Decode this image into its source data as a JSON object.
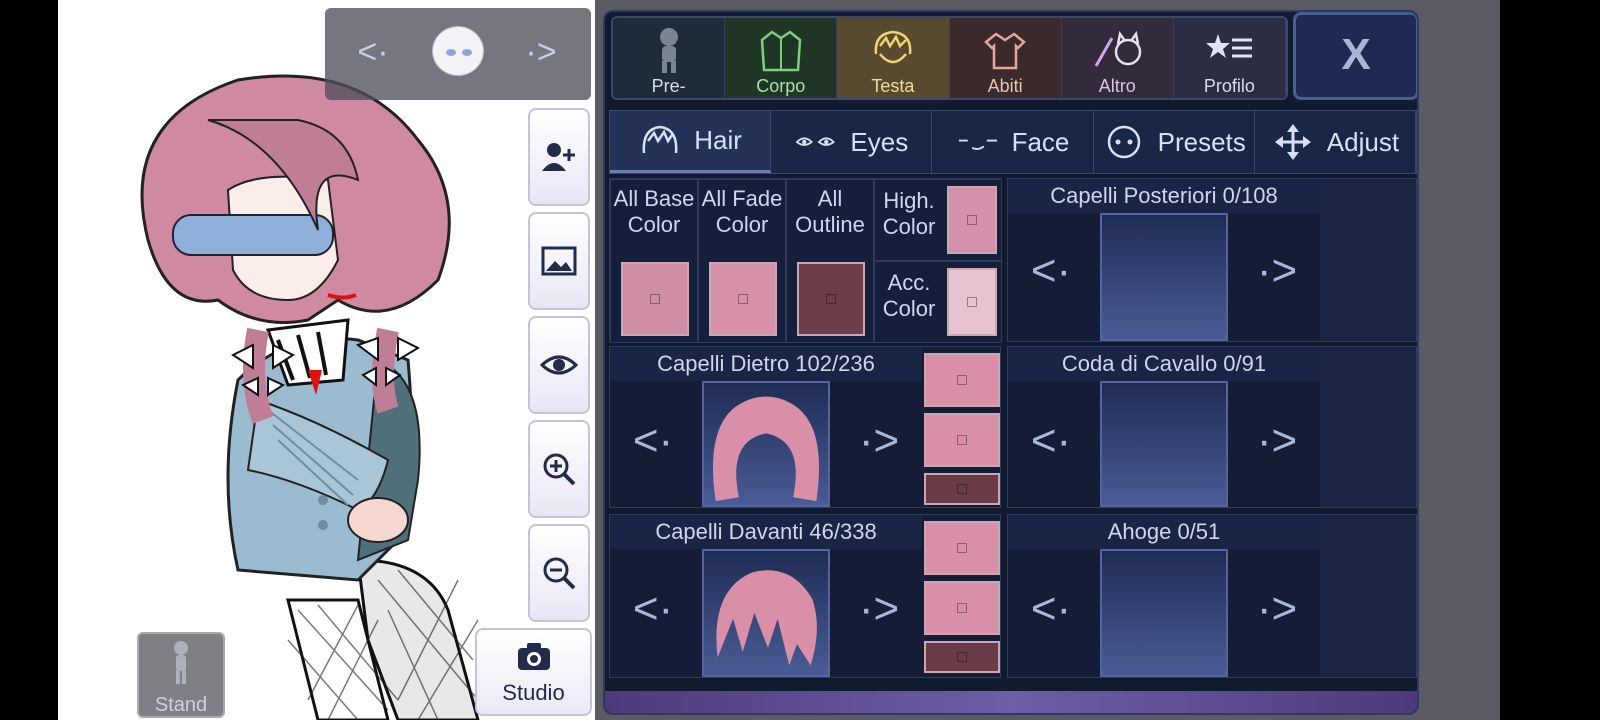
{
  "stage": {
    "prev_arrow": "<·",
    "next_arrow": "·>",
    "stand_label": "Stand",
    "studio_label": "Studio"
  },
  "top_tabs": [
    {
      "label": "Pre-",
      "icon": "body-silhouette-icon"
    },
    {
      "label": "Corpo",
      "icon": "jacket-icon"
    },
    {
      "label": "Testa",
      "icon": "hair-head-icon"
    },
    {
      "label": "Abiti",
      "icon": "shirt-icon"
    },
    {
      "label": "Altro",
      "icon": "sword-cat-icon"
    },
    {
      "label": "Profilo",
      "icon": "star-list-icon"
    }
  ],
  "close_label": "X",
  "sub_tabs": [
    {
      "label": "Hair",
      "icon": "hair-icon"
    },
    {
      "label": "Eyes",
      "icon": "eyes-icon"
    },
    {
      "label": "Face",
      "icon": "face-icon"
    },
    {
      "label": "Presets",
      "icon": "preset-face-icon"
    },
    {
      "label": "Adjust",
      "icon": "move-arrows-icon"
    }
  ],
  "color_buttons": [
    {
      "label_1": "All Base",
      "label_2": "Color",
      "color": "#cf8ea6"
    },
    {
      "label_1": "All Fade",
      "label_2": "Color",
      "color": "#d791aa"
    },
    {
      "label_1": "All",
      "label_2": "Outline",
      "color": "#6e3e48"
    }
  ],
  "small_colors": [
    {
      "label_1": "High.",
      "label_2": "Color",
      "color": "#d491ab"
    },
    {
      "label_1": "Acc.",
      "label_2": "Color",
      "color": "#e7c2d0"
    }
  ],
  "slots": {
    "capelli_posteriori": "Capelli Posteriori 0/108",
    "capelli_dietro": "Capelli Dietro 102/236",
    "coda_di_cavallo": "Coda di Cavallo 0/91",
    "capelli_davanti": "Capelli Davanti 46/338",
    "ahoge": "Ahoge 0/51"
  },
  "slot_colors": {
    "dietro": [
      "#d98fa8",
      "#d98fa8",
      "#6b3b47"
    ],
    "davanti": [
      "#d98fa8",
      "#d98fa8",
      "#6b3b47"
    ]
  },
  "nav": {
    "left": "<·",
    "right": "·>"
  },
  "colors": {
    "hair": "#d08aa3",
    "outfit": "#8fb3c9",
    "panel": "#121a30"
  }
}
